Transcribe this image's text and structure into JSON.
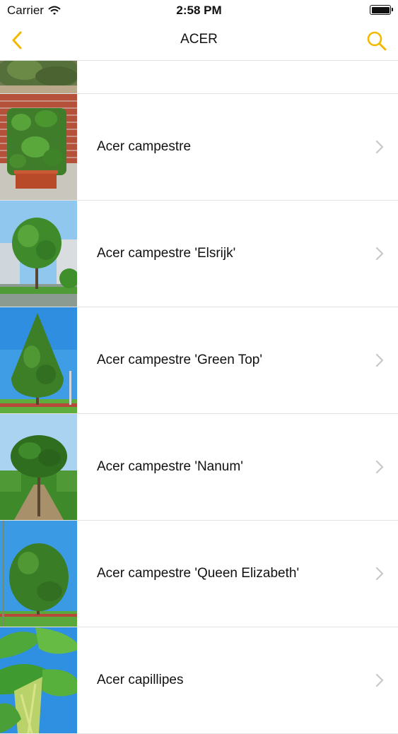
{
  "status_bar": {
    "carrier": "Carrier",
    "time": "2:58 PM"
  },
  "nav": {
    "title": "ACER",
    "back_icon": "chevron-left-icon",
    "search_icon": "search-icon",
    "accent_color": "#F2B900"
  },
  "list": {
    "items": [
      {
        "label": ""
      },
      {
        "label": "Acer campestre"
      },
      {
        "label": "Acer campestre 'Elsrijk'"
      },
      {
        "label": "Acer campestre 'Green Top'"
      },
      {
        "label": "Acer campestre 'Nanum'"
      },
      {
        "label": "Acer campestre 'Queen Elizabeth'"
      },
      {
        "label": "Acer capillipes"
      }
    ]
  }
}
